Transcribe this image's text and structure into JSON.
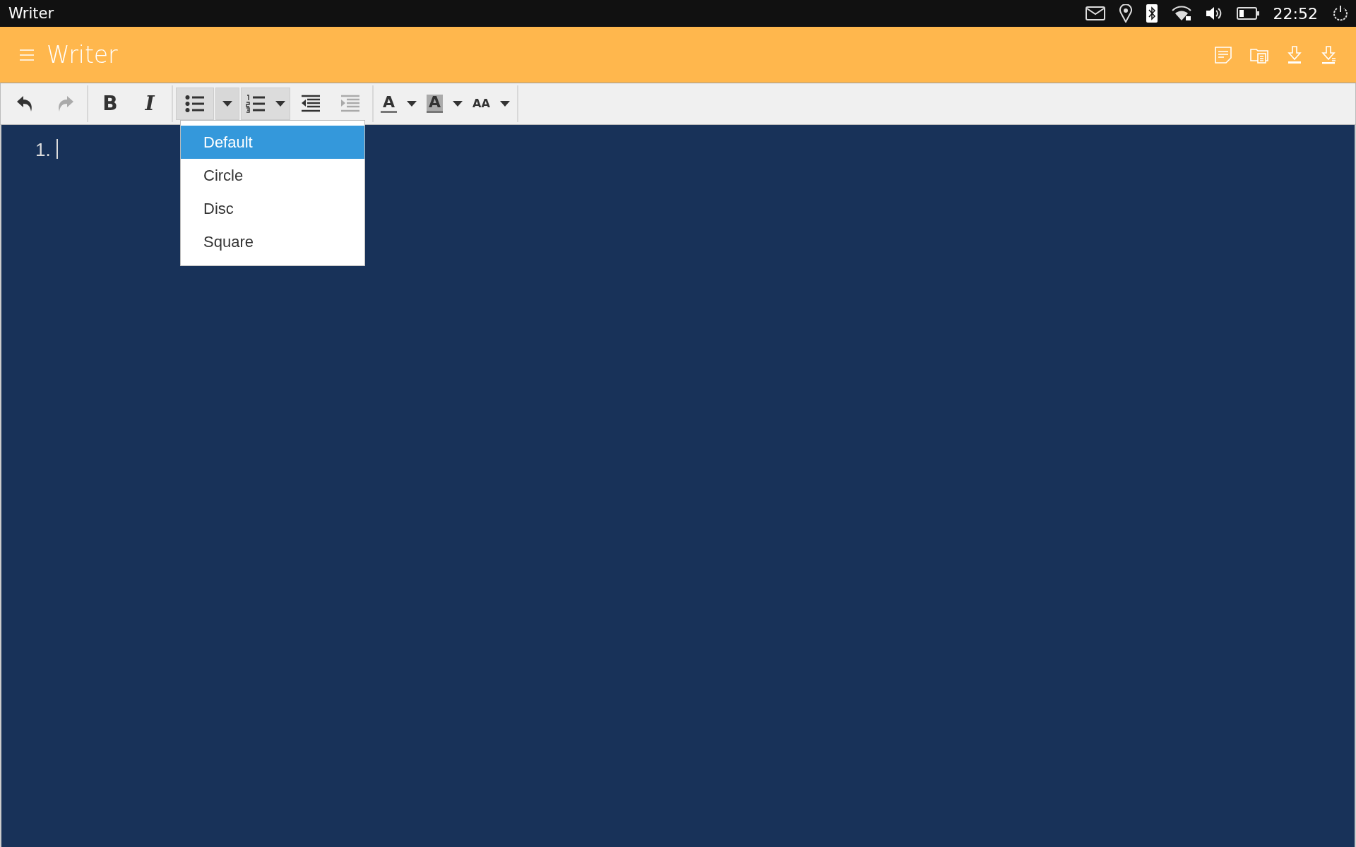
{
  "status_bar": {
    "app_name": "Writer",
    "time": "22:52"
  },
  "header": {
    "title": "Writer"
  },
  "toolbar": {
    "groups": [
      [
        {
          "kind": "undo",
          "disabled": false,
          "pressed": false
        },
        {
          "kind": "redo",
          "disabled": true,
          "pressed": false
        }
      ],
      [
        {
          "kind": "bold",
          "glyph": "B",
          "disabled": false,
          "pressed": false
        },
        {
          "kind": "italic",
          "glyph": "I",
          "disabled": false,
          "pressed": false
        }
      ],
      [
        {
          "kind": "bullet-list",
          "disabled": false,
          "pressed": true,
          "menu_open": true
        },
        {
          "kind": "numbered-list",
          "disabled": false,
          "pressed": true
        },
        {
          "kind": "outdent",
          "disabled": false,
          "pressed": false
        },
        {
          "kind": "indent",
          "disabled": true,
          "pressed": false
        }
      ],
      [
        {
          "kind": "font-color",
          "glyph": "A",
          "disabled": false,
          "pressed": false
        },
        {
          "kind": "highlight",
          "glyph": "A",
          "disabled": false,
          "pressed": false
        },
        {
          "kind": "font-size",
          "glyph": "AA",
          "disabled": false,
          "pressed": false
        }
      ]
    ]
  },
  "list_style_menu": {
    "items": [
      {
        "label": "Default",
        "selected": true
      },
      {
        "label": "Circle",
        "selected": false
      },
      {
        "label": "Disc",
        "selected": false
      },
      {
        "label": "Square",
        "selected": false
      }
    ]
  },
  "editor": {
    "list_marker": "1."
  }
}
